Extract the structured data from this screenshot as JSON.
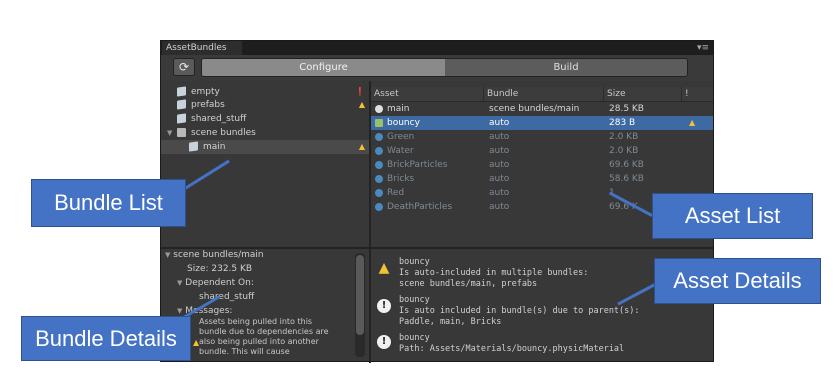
{
  "window": {
    "tab_title": "AssetBundles",
    "menu_icon": "menu-icon"
  },
  "toolbar": {
    "refresh_icon": "refresh-icon",
    "tabs": [
      "Configure",
      "Build"
    ],
    "active_tab": "Configure"
  },
  "bundle_list": {
    "items": [
      {
        "label": "empty",
        "icon": "bundle-cube-icon",
        "status": "info-icon"
      },
      {
        "label": "prefabs",
        "icon": "bundle-cube-icon",
        "status": "warning-icon"
      },
      {
        "label": "shared_stuff",
        "icon": "bundle-cube-icon",
        "status": ""
      },
      {
        "label": "scene bundles",
        "icon": "folder-icon",
        "status": "",
        "expanded": true
      },
      {
        "label": "main",
        "icon": "bundle-cube-icon",
        "status": "warning-icon",
        "selected": true
      }
    ]
  },
  "bundle_details": {
    "title": "scene bundles/main",
    "size": "Size: 232.5 KB",
    "dependent_on_label": "Dependent On:",
    "dependent_on": "shared_stuff",
    "messages_label": "Messages:",
    "message_text": "Assets being pulled into this bundle due to dependencies are also being pulled into another bundle.  This will cause"
  },
  "asset_list": {
    "columns": [
      "Asset",
      "Bundle",
      "Size",
      "!"
    ],
    "rows": [
      {
        "asset": "main",
        "bundle": "scene bundles/main",
        "size": "28.5 KB",
        "status": "",
        "style": "main"
      },
      {
        "asset": "bouncy",
        "bundle": "auto",
        "size": "283 B",
        "status": "warning-icon",
        "style": "selected"
      },
      {
        "asset": "Green",
        "bundle": "auto",
        "size": "2.0 KB",
        "status": "",
        "style": "dim"
      },
      {
        "asset": "Water",
        "bundle": "auto",
        "size": "2.0 KB",
        "status": "",
        "style": "dim"
      },
      {
        "asset": "BrickParticles",
        "bundle": "auto",
        "size": "69.6 KB",
        "status": "",
        "style": "dim"
      },
      {
        "asset": "Bricks",
        "bundle": "auto",
        "size": "58.6 KB",
        "status": "",
        "style": "dim"
      },
      {
        "asset": "Red",
        "bundle": "auto",
        "size": "1",
        "status": "",
        "style": "dim"
      },
      {
        "asset": "DeathParticles",
        "bundle": "auto",
        "size": "69.6 K",
        "status": "",
        "style": "dim"
      }
    ]
  },
  "asset_details": {
    "messages": [
      {
        "icon": "warning-icon",
        "lines": [
          "bouncy",
          "Is auto-included in multiple bundles:",
          "scene bundles/main, prefabs"
        ]
      },
      {
        "icon": "info-icon",
        "lines": [
          "bouncy",
          "Is auto included in bundle(s) due to parent(s):",
          "Paddle, main, Bricks"
        ]
      },
      {
        "icon": "info-icon",
        "lines": [
          "bouncy",
          "Path: Assets/Materials/bouncy.physicMaterial"
        ]
      }
    ]
  },
  "callouts": {
    "bundle_list": "Bundle List",
    "asset_list": "Asset List",
    "asset_details": "Asset Details",
    "bundle_details": "Bundle Details"
  },
  "colors": {
    "callout": "#4472c4",
    "selection": "#3d6aa3",
    "warning": "#f1c232",
    "panel": "#383838"
  }
}
